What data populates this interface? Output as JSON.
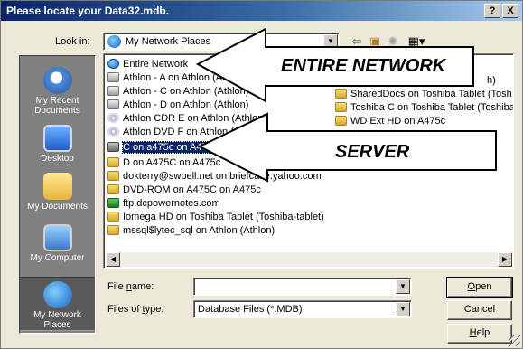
{
  "window": {
    "title": "Please locate your Data32.mdb.",
    "help_button": "?",
    "close_button": "X"
  },
  "lookin": {
    "label": "Look in:",
    "value": "My Network Places"
  },
  "toolbar": {
    "back_icon": "back-arrow-icon",
    "up_icon": "up-folder-icon",
    "new_folder_icon": "new-folder-icon",
    "views_icon": "views-menu-icon"
  },
  "places": [
    {
      "label": "My Recent Documents",
      "icon": "recent-documents-icon"
    },
    {
      "label": "Desktop",
      "icon": "desktop-icon"
    },
    {
      "label": "My Documents",
      "icon": "my-documents-icon"
    },
    {
      "label": "My Computer",
      "icon": "my-computer-icon"
    },
    {
      "label": "My Network Places",
      "icon": "network-places-icon",
      "selected": true
    }
  ],
  "files_left": [
    {
      "label": "Entire Network",
      "icon": "network"
    },
    {
      "label": "Athlon - A on Athlon (Athlon)",
      "icon": "drive"
    },
    {
      "label": "Athlon - C on Athlon (Athlon)",
      "icon": "drive"
    },
    {
      "label": "Athlon - D on Athlon (Athlon)",
      "icon": "drive"
    },
    {
      "label": "Athlon CDR E on Athlon (Athlon)",
      "icon": "cd"
    },
    {
      "label": "Athlon DVD F on Athlon (Athlon)",
      "icon": "cd"
    },
    {
      "label": "C on a475c on A475c",
      "icon": "server",
      "selected": true
    },
    {
      "label": "D on A475C on A475c",
      "icon": "folder"
    },
    {
      "label": "dokterry@swbell.net on briefcase.yahoo.com",
      "icon": "folder"
    },
    {
      "label": "DVD-ROM on A475C on A475c",
      "icon": "folder"
    },
    {
      "label": "ftp.dcpowernotes.com",
      "icon": "web"
    },
    {
      "label": "Iomega HD on Toshiba Tablet (Toshiba-tablet)",
      "icon": "folder"
    },
    {
      "label": "mssql$lytec_sql on Athlon (Athlon)",
      "icon": "folder"
    }
  ],
  "files_right": [
    {
      "label": "h)",
      "icon": "folder"
    },
    {
      "label": "SharedDocs on Toshiba Tablet (Tosh",
      "icon": "folder"
    },
    {
      "label": "Toshiba C on Toshiba Tablet (Toshiba",
      "icon": "folder"
    },
    {
      "label": "WD Ext HD on A475c",
      "icon": "folder"
    }
  ],
  "filename": {
    "label_pre": "File ",
    "label_u": "n",
    "label_post": "ame:",
    "value": ""
  },
  "filetype": {
    "label_pre": "Files of ",
    "label_u": "t",
    "label_post": "ype:",
    "value": "Database Files (*.MDB)"
  },
  "buttons": {
    "open_u": "O",
    "open_rest": "pen",
    "cancel": "Cancel",
    "help_u": "H",
    "help_rest": "elp"
  },
  "callouts": {
    "entire_network": "ENTIRE NETWORK",
    "server": "SERVER"
  },
  "colors": {
    "titlebar": "#0a246a",
    "selection": "#0a246a",
    "places_bar": "#808080"
  }
}
